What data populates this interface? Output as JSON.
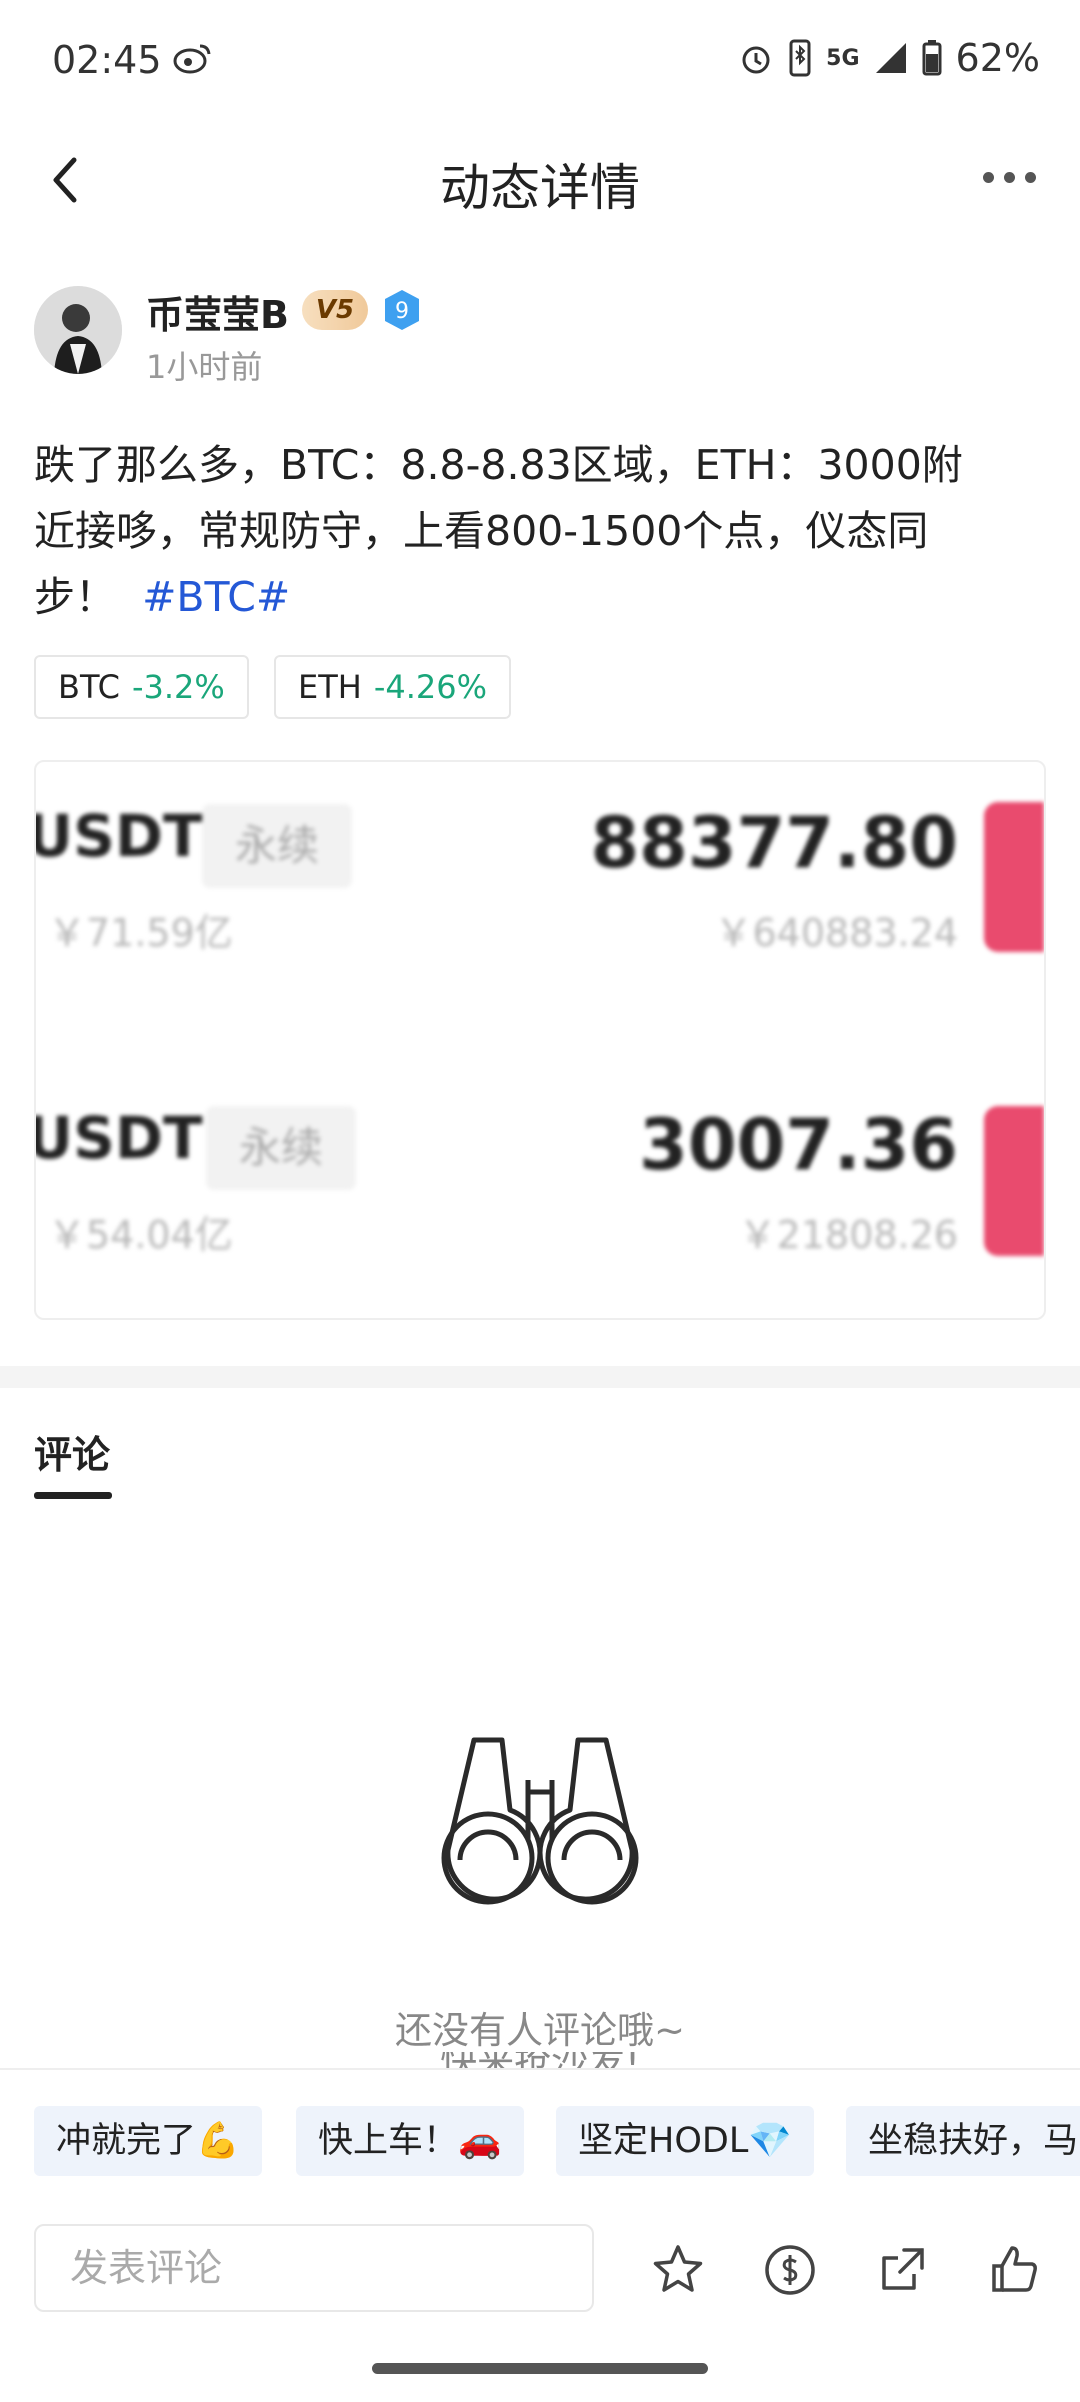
{
  "status_bar": {
    "time": "02:45",
    "network": "5G",
    "battery": "62%"
  },
  "header": {
    "title": "动态详情"
  },
  "author": {
    "name": "币莹莹B",
    "vip_badge": "V5",
    "level": "9",
    "time_ago": "1小时前"
  },
  "post": {
    "text_line1": "跌了那么多，BTC：8.8-8.83区域，ETH：3000附",
    "text_line2": "近接哆，常规防守，上看800-1500个点，仪态同",
    "text_line3": "步！",
    "hashtag": "#BTC#"
  },
  "tickers": [
    {
      "symbol": "BTC",
      "change": "-3.2%"
    },
    {
      "symbol": "ETH",
      "change": "-4.26%"
    }
  ],
  "market_card": {
    "rows": [
      {
        "symbol": "USDT",
        "type": "永续",
        "volume": "￥71.59亿",
        "price": "88377.80",
        "price_cny": "￥640883.24"
      },
      {
        "symbol": "USDT",
        "type": "永续",
        "volume": "￥54.04亿",
        "price": "3007.36",
        "price_cny": "￥21808.26"
      }
    ]
  },
  "comments": {
    "tab_label": "评论",
    "empty_line1": "还没有人评论哦~",
    "empty_line2": "快来抢沙发!"
  },
  "quick_replies": [
    "冲就完了💪",
    "快上车！🚗",
    "坚定HODL💎",
    "坐稳扶好，马"
  ],
  "input": {
    "placeholder": "发表评论"
  },
  "icons": {
    "back": "back-arrow-icon",
    "more": "more-icon",
    "favorite": "star-icon",
    "tip": "coin-icon",
    "share": "share-icon",
    "like": "thumbs-up-icon"
  },
  "colors": {
    "hashtag": "#2458d6",
    "down": "#1aa67a",
    "trade_button": "#e94b6e"
  }
}
